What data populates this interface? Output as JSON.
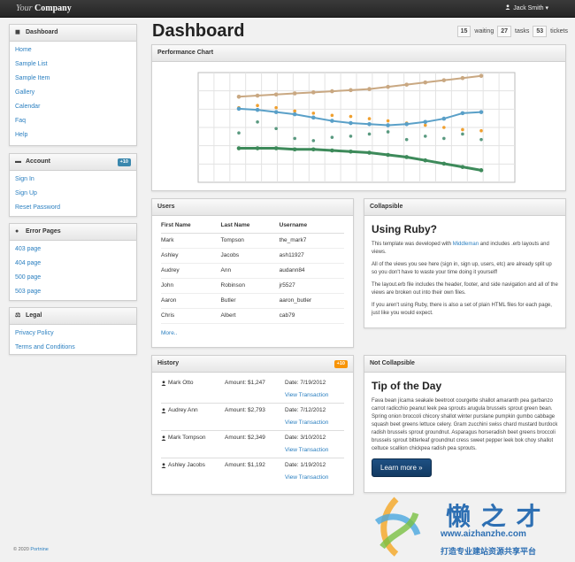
{
  "brand": {
    "italic": "Your",
    "bold": "Company"
  },
  "user": {
    "name": "Jack Smith ▾"
  },
  "sidebar": {
    "dashboard": {
      "title": "Dashboard",
      "items": [
        "Home",
        "Sample List",
        "Sample Item",
        "Gallery",
        "Calendar",
        "Faq",
        "Help"
      ]
    },
    "account": {
      "title": "Account",
      "badge": "+10",
      "items": [
        "Sign In",
        "Sign Up",
        "Reset Password"
      ]
    },
    "errors": {
      "title": "Error Pages",
      "items": [
        "403 page",
        "404 page",
        "500 page",
        "503 page"
      ]
    },
    "legal": {
      "title": "Legal",
      "items": [
        "Privacy Policy",
        "Terms and Conditions"
      ]
    }
  },
  "page": {
    "title": "Dashboard"
  },
  "stats": [
    {
      "count": "15",
      "label": "waiting"
    },
    {
      "count": "27",
      "label": "tasks"
    },
    {
      "count": "53",
      "label": "tickets"
    }
  ],
  "chart_panel": {
    "title": "Performance Chart"
  },
  "chart_data": {
    "type": "line",
    "title": "",
    "xlabel": "",
    "ylabel": "",
    "ylim": [
      0,
      100
    ],
    "x": [
      1,
      2,
      3,
      4,
      5,
      6,
      7,
      8,
      9,
      10,
      11,
      12,
      13,
      14
    ],
    "grid": true,
    "series": [
      {
        "color": "#c9a882",
        "style": "line",
        "values": [
          78,
          79,
          80,
          81,
          82,
          83,
          84,
          85,
          87,
          89,
          91,
          93,
          95,
          97
        ]
      },
      {
        "color": "#f0a030",
        "style": "scatter",
        "values": [
          68,
          70,
          68,
          65,
          63,
          61,
          60,
          58,
          56,
          54,
          52,
          50,
          48,
          47
        ]
      },
      {
        "color": "#5aa0c8",
        "style": "line",
        "values": [
          67,
          66,
          64,
          62,
          59,
          56,
          54,
          53,
          52,
          53,
          55,
          58,
          63,
          64
        ]
      },
      {
        "color": "#5a9a80",
        "style": "scatter",
        "values": [
          45,
          55,
          49,
          40,
          38,
          41,
          42,
          44,
          46,
          39,
          42,
          40,
          44,
          39
        ]
      },
      {
        "color": "#3d8a5a",
        "style": "line",
        "values": [
          31,
          31,
          31,
          30,
          30,
          29,
          28,
          27,
          25,
          23,
          20,
          17,
          14,
          11
        ]
      }
    ]
  },
  "users": {
    "title": "Users",
    "headers": [
      "First Name",
      "Last Name",
      "Username"
    ],
    "rows": [
      [
        "Mark",
        "Tompson",
        "the_mark7"
      ],
      [
        "Ashley",
        "Jacobs",
        "ash11927"
      ],
      [
        "Audrey",
        "Ann",
        "audann84"
      ],
      [
        "John",
        "Robinson",
        "jr5527"
      ],
      [
        "Aaron",
        "Butler",
        "aaron_butler"
      ],
      [
        "Chris",
        "Albert",
        "cab79"
      ]
    ],
    "more": "More.."
  },
  "collapsible": {
    "title": "Collapsible",
    "heading": "Using Ruby?",
    "p1_pre": "This template was developed with ",
    "p1_link": "Middleman",
    "p1_post": " and includes .erb layouts and views.",
    "p2": "All of the views you see here (sign in, sign up, users, etc) are already split up so you don't have to waste your time doing it yourself!",
    "p3": "The layout.erb file includes the header, footer, and side navigation and all of the views are broken out into their own files.",
    "p4": "If you aren't using Ruby, there is also a set of plain HTML files for each page, just like you would expect."
  },
  "history": {
    "title": "History",
    "badge": "+10",
    "link_label": "View Transaction",
    "rows": [
      {
        "name": "Mark Otto",
        "amount": "Amount: $1,247",
        "date": "Date: 7/19/2012"
      },
      {
        "name": "Audrey Ann",
        "amount": "Amount: $2,793",
        "date": "Date: 7/12/2012"
      },
      {
        "name": "Mark Tompson",
        "amount": "Amount: $2,349",
        "date": "Date: 3/10/2012"
      },
      {
        "name": "Ashley Jacobs",
        "amount": "Amount: $1,192",
        "date": "Date: 1/19/2012"
      }
    ]
  },
  "not_collapsible": {
    "title": "Not Collapsible",
    "heading": "Tip of the Day",
    "text": "Fava bean jícama seakale beetroot courgette shallot amaranth pea garbanzo carrot radicchio peanut leek pea sprouts arugula brussels sprout green bean. Spring onion broccoli chicory shallot winter purslane pumpkin gumbo cabbage squash beet greens lettuce celery. Gram zucchini swiss chard mustard burdock radish brussels sprout groundnut. Asparagus horseradish beet greens broccoli brussels sprout bitterleaf groundnut cress sweet pepper leek bok choy shallot celtuce scallion chickpea radish pea sprouts.",
    "button": "Learn more »"
  },
  "footer": {
    "prefix": "© 2020 ",
    "link": "Portnine"
  },
  "watermark": {
    "title": "懒 之 才",
    "url": "www.aizhanzhe.com",
    "slogan": "打造专业建站资源共享平台"
  }
}
